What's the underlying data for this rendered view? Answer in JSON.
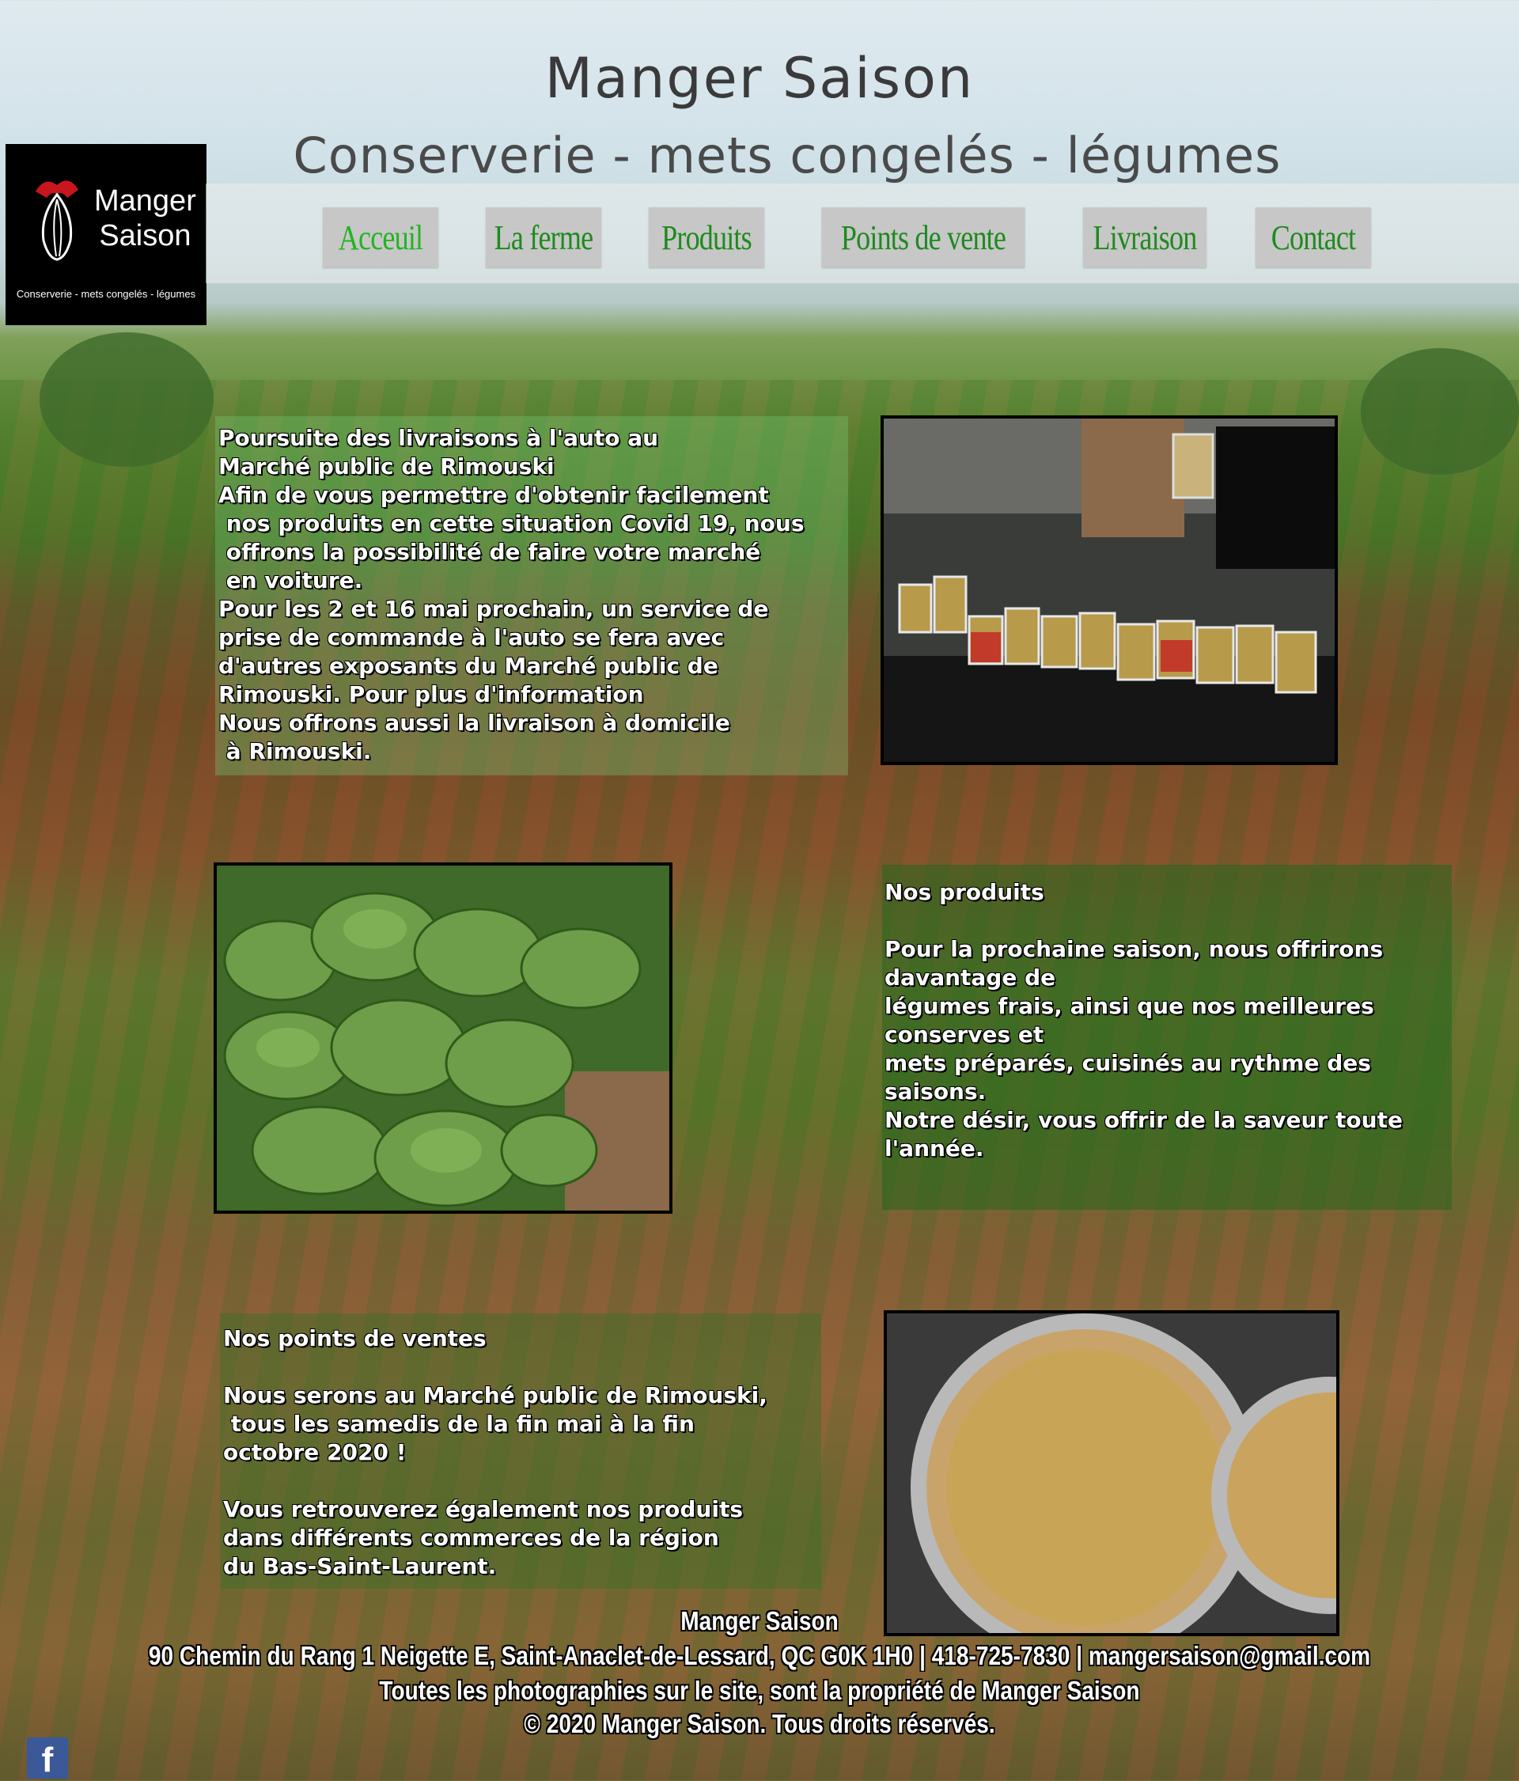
{
  "header": {
    "title": "Manger Saison",
    "subtitle": "Conserverie - mets congelés - légumes"
  },
  "logo": {
    "line1": "Manger",
    "line2": "Saison",
    "tagline": "Conserverie - mets congelés - légumes"
  },
  "nav": {
    "items": [
      {
        "label": "Acceuil",
        "active": true
      },
      {
        "label": "La ferme"
      },
      {
        "label": "Produits"
      },
      {
        "label": "Points de vente"
      },
      {
        "label": "Livraison"
      },
      {
        "label": "Contact"
      }
    ]
  },
  "sections": {
    "delivery": {
      "text": "Poursuite des livraisons à l'auto au\nMarché public de Rimouski\nAfin de vous permettre d'obtenir facilement\n nos produits en cette situation Covid 19, nous\n offrons la possibilité de faire votre marché\n en voiture.\nPour les 2 et 16 mai prochain, un service de\nprise de commande à l'auto se fera avec\nd'autres exposants du Marché public de\nRimouski. Pour plus d'information\nNous offrons aussi la livraison à domicile\n à Rimouski."
    },
    "products": {
      "text": "Nos produits\n\nPour la prochaine saison, nous offrirons\ndavantage de\nlégumes frais, ainsi que nos meilleures\nconserves et\nmets préparés, cuisinés au rythme des\nsaisons.\nNotre désir, vous offrir de la saveur toute\nl'année."
    },
    "points_of_sale": {
      "text": "Nos points de ventes\n\nNous serons au Marché public de Rimouski,\n tous les samedis de la fin mai à la fin\noctobre 2020 !\n\nVous retrouverez également nos produits\ndans différents commerces de la région\ndu Bas-Saint-Laurent."
    }
  },
  "footer": {
    "name": "Manger Saison",
    "contact": "90 Chemin du Rang 1 Neigette E, Saint-Anaclet-de-Lessard, QC G0K 1H0  |  418-725-7830  |  mangersaison@gmail.com",
    "photos_note": "Toutes les photographies sur le site, sont la propriété de Manger Saison",
    "copyright": "© 2020 Manger Saison. Tous droits réservés."
  },
  "social": {
    "facebook_glyph": "f"
  },
  "colors": {
    "nav_text": "#1e8a1e",
    "nav_active": "#22b422",
    "nav_bg": "#c7c7c7",
    "panel_bg": "rgba(30,90,30,.45)"
  }
}
